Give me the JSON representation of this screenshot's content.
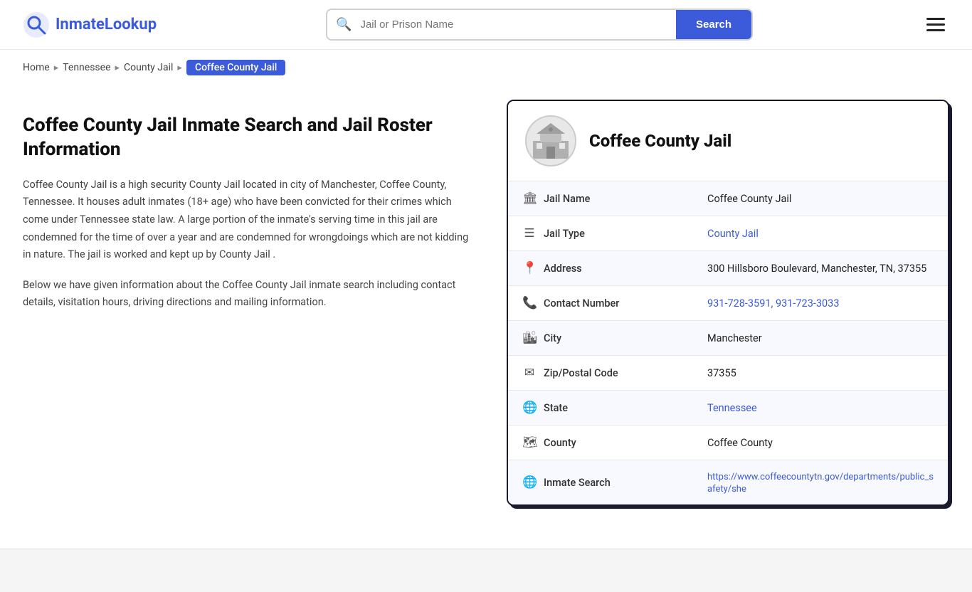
{
  "logo": {
    "text_part1": "Inmate",
    "text_part2": "Lookup"
  },
  "search": {
    "placeholder": "Jail or Prison Name",
    "button_label": "Search"
  },
  "breadcrumb": {
    "items": [
      {
        "label": "Home",
        "href": "#"
      },
      {
        "label": "Tennessee",
        "href": "#"
      },
      {
        "label": "County Jail",
        "href": "#"
      },
      {
        "label": "Coffee County Jail",
        "current": true
      }
    ]
  },
  "left": {
    "title": "Coffee County Jail Inmate Search and Jail Roster Information",
    "desc1": "Coffee County Jail is a high security County Jail located in city of Manchester, Coffee County, Tennessee. It houses adult inmates (18+ age) who have been convicted for their crimes which come under Tennessee state law. A large portion of the inmate's serving time in this jail are condemned for the time of over a year and are condemned for wrongdoings which are not kidding in nature. The jail is worked and kept up by County Jail .",
    "desc2": "Below we have given information about the Coffee County Jail inmate search including contact details, visitation hours, driving directions and mailing information."
  },
  "card": {
    "jail_name": "Coffee County Jail",
    "rows": [
      {
        "icon": "jail-icon",
        "label": "Jail Name",
        "value": "Coffee County Jail",
        "link": null
      },
      {
        "icon": "list-icon",
        "label": "Jail Type",
        "value": "County Jail",
        "link": "#"
      },
      {
        "icon": "pin-icon",
        "label": "Address",
        "value": "300 Hillsboro Boulevard, Manchester, TN, 37355",
        "link": null
      },
      {
        "icon": "phone-icon",
        "label": "Contact Number",
        "value": "931-728-3591, 931-723-3033",
        "link": "#"
      },
      {
        "icon": "city-icon",
        "label": "City",
        "value": "Manchester",
        "link": null
      },
      {
        "icon": "mail-icon",
        "label": "Zip/Postal Code",
        "value": "37355",
        "link": null
      },
      {
        "icon": "globe-icon",
        "label": "State",
        "value": "Tennessee",
        "link": "#"
      },
      {
        "icon": "county-icon",
        "label": "County",
        "value": "Coffee County",
        "link": null
      },
      {
        "icon": "search-icon",
        "label": "Inmate Search",
        "value": "https://www.coffeecountytn.gov/departments/public_safety/she",
        "link": "https://www.coffeecountytn.gov/departments/public_safety/she"
      }
    ]
  }
}
